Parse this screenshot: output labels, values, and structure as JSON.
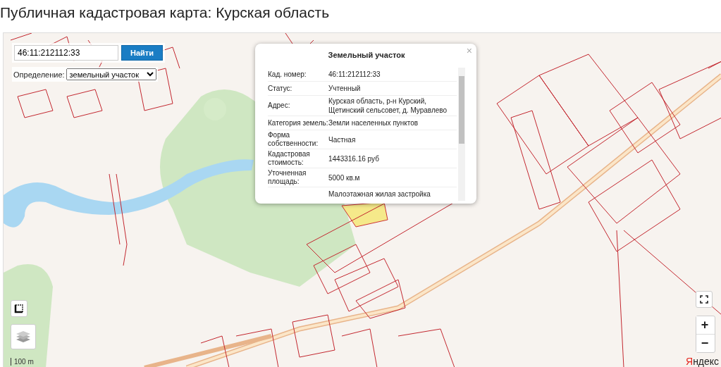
{
  "page_title": "Публичная кадастровая карта: Курская область",
  "search": {
    "value": "46:11:212112:33",
    "button": "Найти"
  },
  "definition": {
    "label": "Определение:",
    "value": "земельный участок"
  },
  "popup": {
    "title": "Земельный участок",
    "close": "×",
    "rows": [
      {
        "label": "Кад. номер:",
        "value": "46:11:212112:33"
      },
      {
        "label": "Статус:",
        "value": "Учтенный"
      },
      {
        "label": "Адрес:",
        "value": "Курская область, р-н Курский, Щетинский сельсовет, д. Муравлево"
      },
      {
        "label": "Категория земель:",
        "value": "Земли населенных пунктов"
      },
      {
        "label": "Форма собственности:",
        "value": "Частная"
      },
      {
        "label": "Кадастровая стоимость:",
        "value": "1443316.16 руб"
      },
      {
        "label": "Уточненная площадь:",
        "value": "5000 кв.м"
      },
      {
        "value": "Малоэтажная жилая застройка"
      }
    ]
  },
  "map": {
    "scale": "100 m",
    "provider_logo": "Яндекс"
  },
  "controls": {
    "zoom_in": "+",
    "zoom_out": "−"
  }
}
